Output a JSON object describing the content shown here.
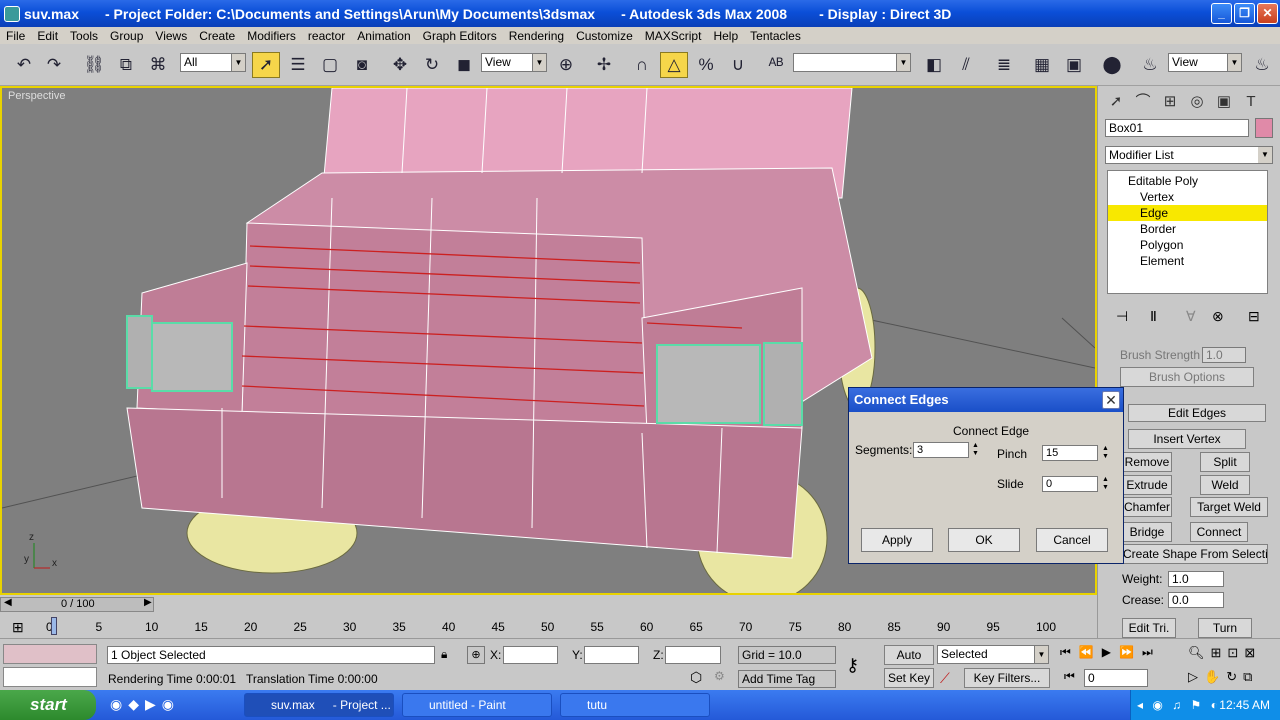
{
  "window": {
    "file": "suv.max",
    "project": "- Project Folder: C:\\Documents and Settings\\Arun\\My Documents\\3dsmax",
    "app": "- Autodesk 3ds Max 2008",
    "display": "- Display : Direct 3D"
  },
  "menu": [
    "File",
    "Edit",
    "Tools",
    "Group",
    "Views",
    "Create",
    "Modifiers",
    "reactor",
    "Animation",
    "Graph Editors",
    "Rendering",
    "Customize",
    "MAXScript",
    "Help",
    "Tentacles"
  ],
  "toolbar": {
    "filter": "All",
    "refcoord": "View",
    "view2": "View",
    "named_sel": ""
  },
  "viewport": {
    "label": "Perspective",
    "axes": {
      "z": "z",
      "y": "y",
      "x": "x"
    }
  },
  "panel": {
    "object_name": "Box01",
    "object_color": "#e08aa8",
    "modifier_list": "Modifier List",
    "stack": [
      "Editable Poly",
      "Vertex",
      "Edge",
      "Border",
      "Polygon",
      "Element"
    ],
    "brush_strength_label": "Brush Strength",
    "brush_strength": "1.0",
    "brush_options": "Brush Options",
    "edit_edges": "Edit Edges",
    "insert_vertex": "Insert Vertex",
    "remove": "Remove",
    "split": "Split",
    "extrude": "Extrude",
    "weld": "Weld",
    "chamfer": "Chamfer",
    "target_weld": "Target Weld",
    "bridge": "Bridge",
    "connect": "Connect",
    "create_shape": "Create Shape From Selection",
    "weight_label": "Weight:",
    "weight": "1.0",
    "crease_label": "Crease:",
    "crease": "0.0",
    "edit_tri": "Edit Tri.",
    "turn": "Turn"
  },
  "dialog": {
    "title": "Connect Edges",
    "group": "Connect Edge",
    "segments_label": "Segments:",
    "segments": "3",
    "pinch_label": "Pinch",
    "pinch": "15",
    "slide_label": "Slide",
    "slide": "0",
    "apply": "Apply",
    "ok": "OK",
    "cancel": "Cancel"
  },
  "timeline": {
    "frame": "0 / 100",
    "ticks": [
      "0",
      "5",
      "10",
      "15",
      "20",
      "25",
      "30",
      "35",
      "40",
      "45",
      "50",
      "55",
      "60",
      "65",
      "70",
      "75",
      "80",
      "85",
      "90",
      "95",
      "100"
    ]
  },
  "status": {
    "selected": "1 Object Selected",
    "render_time": "Rendering Time  0:00:01",
    "translation_time": "Translation Time  0:00:00",
    "x_label": "X:",
    "y_label": "Y:",
    "z_label": "Z:",
    "grid": "Grid = 10.0",
    "add_time_tag": "Add Time Tag",
    "auto_key": "Auto Key",
    "selected_combo": "Selected",
    "set_key": "Set Key",
    "key_filters": "Key Filters...",
    "frame_field": "0"
  },
  "taskbar": {
    "start": "start",
    "tasks": [
      "suv.max",
      "- Project ...",
      "untitled - Paint",
      "tutu"
    ],
    "clock": "12:45 AM"
  },
  "colors": {
    "accent": "#f8e800",
    "mesh": "#c58aa0",
    "mesh_edge": "#ffffff",
    "selected_edge": "#cc2020",
    "tire": "#e8e6a0"
  }
}
